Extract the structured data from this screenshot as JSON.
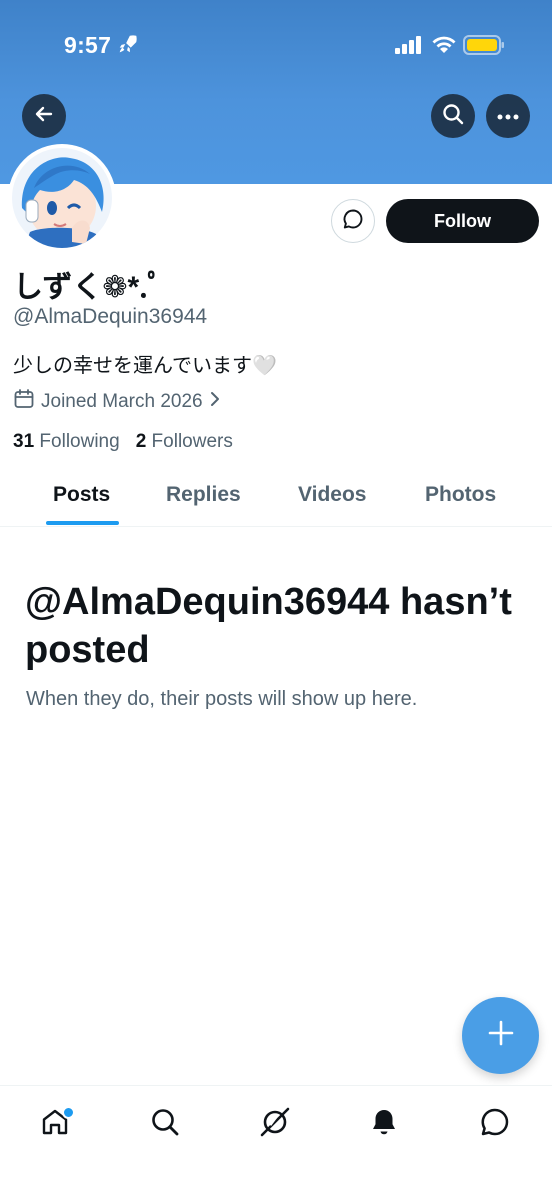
{
  "status_bar": {
    "time": "9:57"
  },
  "header": {
    "back_icon": "arrow-left-icon",
    "search_icon": "search-icon",
    "more_icon": "more-horizontal-icon"
  },
  "profile": {
    "display_name": "しずく❁*.ﾟ",
    "handle": "@AlmaDequin36944",
    "bio": "少しの幸せを運んでいます🤍",
    "joined": "Joined March 2026",
    "following_count": "31",
    "following_label": "Following",
    "followers_count": "2",
    "followers_label": "Followers",
    "follow_label": "Follow"
  },
  "tabs": [
    {
      "label": "Posts",
      "active": true
    },
    {
      "label": "Replies",
      "active": false
    },
    {
      "label": "Videos",
      "active": false
    },
    {
      "label": "Photos",
      "active": false
    }
  ],
  "empty_state": {
    "title": "@AlmaDequin36944 hasn’t posted",
    "subtitle": "When they do, their posts will show up here."
  },
  "bottom_nav": [
    {
      "icon": "home-icon",
      "has_badge": true
    },
    {
      "icon": "search-icon",
      "has_badge": false
    },
    {
      "icon": "grok-icon",
      "has_badge": false
    },
    {
      "icon": "bell-icon",
      "has_badge": false
    },
    {
      "icon": "chat-icon",
      "has_badge": false
    }
  ],
  "colors": {
    "banner": "#4f98e2",
    "accent": "#1d9bf0",
    "fab": "#4a9ee6",
    "text_primary": "#0f1419",
    "text_secondary": "#536471"
  }
}
